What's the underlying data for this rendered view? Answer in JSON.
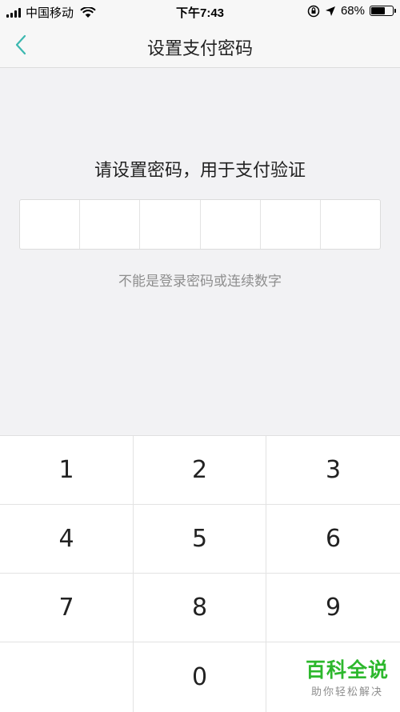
{
  "status_bar": {
    "carrier": "中国移动",
    "time": "下午7:43",
    "battery_percent": "68%",
    "battery_level": 0.68,
    "icons": [
      "signal-icon",
      "wifi-icon",
      "rotation-lock-icon",
      "location-arrow-icon",
      "battery-icon"
    ]
  },
  "nav": {
    "title": "设置支付密码",
    "back_icon": "chevron-left-icon",
    "accent_color": "#3cb8b0"
  },
  "main": {
    "prompt": "请设置密码，用于支付验证",
    "pin_length": 6,
    "hint": "不能是登录密码或连续数字"
  },
  "keypad": {
    "keys": [
      "1",
      "2",
      "3",
      "4",
      "5",
      "6",
      "7",
      "8",
      "9",
      "",
      "0",
      ""
    ]
  },
  "watermark": {
    "brand": "百科全说",
    "slogan": "助你轻松解决",
    "color": "#2db82d"
  }
}
